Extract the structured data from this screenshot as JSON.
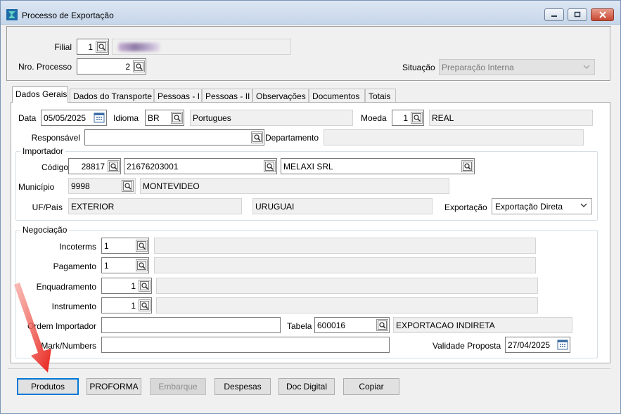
{
  "window": {
    "title": "Processo de Exportação",
    "buttons": [
      "minimize",
      "maximize",
      "close"
    ]
  },
  "header": {
    "filial_label": "Filial",
    "filial_value": "1",
    "nro_processo_label": "Nro. Processo",
    "nro_processo_value": "2",
    "situacao_label": "Situação",
    "situacao_value": "Preparação Interna"
  },
  "tabs": [
    {
      "label": "Dados Gerais",
      "active": true
    },
    {
      "label": "Dados do Transporte"
    },
    {
      "label": "Pessoas - I"
    },
    {
      "label": "Pessoas - II"
    },
    {
      "label": "Observações"
    },
    {
      "label": "Documentos"
    },
    {
      "label": "Totais"
    }
  ],
  "dados_gerais": {
    "data_label": "Data",
    "data_value": "05/05/2025",
    "idioma_label": "Idioma",
    "idioma_code": "BR",
    "idioma_desc": "Portugues",
    "moeda_label": "Moeda",
    "moeda_code": "1",
    "moeda_desc": "REAL",
    "responsavel_label": "Responsável",
    "responsavel_value": "",
    "departamento_label": "Departamento",
    "departamento_value": ""
  },
  "importador": {
    "group_title": "Importador",
    "codigo_label": "Código",
    "codigo_value": "28817",
    "documento_value": "21676203001",
    "nome_value": "MELAXI SRL",
    "municipio_label": "Município",
    "municipio_code": "9998",
    "municipio_desc": "MONTEVIDEO",
    "uf_pais_label": "UF/País",
    "uf_value": "EXTERIOR",
    "pais_value": "URUGUAI",
    "exportacao_label": "Exportação",
    "exportacao_value": "Exportação Direta"
  },
  "negociacao": {
    "group_title": "Negociação",
    "incoterms_label": "Incoterms",
    "incoterms_value": "1",
    "pagamento_label": "Pagamento",
    "pagamento_value": "1",
    "enquadramento_label": "Enquadramento",
    "enquadramento_value": "1",
    "instrumento_label": "Instrumento",
    "instrumento_value": "1",
    "ordem_label": "Ordem Importador",
    "ordem_value": "",
    "tabela_label": "Tabela",
    "tabela_value": "600016",
    "tabela_desc": "EXPORTACAO INDIRETA",
    "mark_label": "Mark/Numbers",
    "mark_value": "",
    "validade_label": "Validade Proposta",
    "validade_value": "27/04/2025"
  },
  "actions": {
    "produtos": "Produtos",
    "proforma": "PROFORMA",
    "embarque": "Embarque",
    "despesas": "Despesas",
    "doc_digital": "Doc Digital",
    "copiar": "Copiar"
  },
  "colors": {
    "annotation_arrow": "#e8231b",
    "focus_border": "#0078d7"
  }
}
